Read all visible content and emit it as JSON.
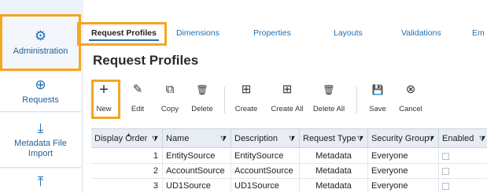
{
  "sidebar": {
    "items": [
      {
        "label": "Administration",
        "icon": "gear-plus-icon",
        "glyph": "⚙",
        "active": true
      },
      {
        "label": "Requests",
        "icon": "add-request-icon",
        "glyph": "⊕",
        "active": false
      },
      {
        "label": "Metadata File Import",
        "icon": "download-icon",
        "glyph": "⤓",
        "active": false
      },
      {
        "label": "",
        "icon": "upload-icon",
        "glyph": "⤒",
        "active": false
      }
    ]
  },
  "tabs": [
    {
      "label": "Request Profiles",
      "active": true
    },
    {
      "label": "Dimensions",
      "active": false
    },
    {
      "label": "Properties",
      "active": false
    },
    {
      "label": "Layouts",
      "active": false
    },
    {
      "label": "Validations",
      "active": false
    },
    {
      "label": "Em",
      "active": false
    }
  ],
  "page_title": "Request Profiles",
  "toolbar": {
    "new": {
      "label": "New",
      "glyph": "+"
    },
    "edit": {
      "label": "Edit",
      "glyph": "✎"
    },
    "copy": {
      "label": "Copy",
      "glyph": "⧉"
    },
    "delete": {
      "label": "Delete",
      "glyph": "🗑"
    },
    "create": {
      "label": "Create",
      "glyph": "⊞"
    },
    "create_all": {
      "label": "Create All",
      "glyph": "⊞"
    },
    "delete_all": {
      "label": "Delete All",
      "glyph": "🗑"
    },
    "save": {
      "label": "Save",
      "glyph": "💾"
    },
    "cancel": {
      "label": "Cancel",
      "glyph": "⊗"
    }
  },
  "grid": {
    "columns": [
      "Display Order",
      "Name",
      "Description",
      "Request Type",
      "Security Group",
      "Enabled"
    ],
    "rows": [
      {
        "order": "1",
        "name": "EntitySource",
        "description": "EntitySource",
        "type": "Metadata",
        "group": "Everyone",
        "enabled": false
      },
      {
        "order": "2",
        "name": "AccountSource",
        "description": "AccountSource",
        "type": "Metadata",
        "group": "Everyone",
        "enabled": false
      },
      {
        "order": "3",
        "name": "UD1Source",
        "description": "UD1Source",
        "type": "Metadata",
        "group": "Everyone",
        "enabled": false
      }
    ],
    "filter_glyph": "⧩"
  },
  "colors": {
    "accent": "#1f6fb2",
    "highlight": "#f5a623",
    "rail_bg": "#eef3f9",
    "header_bg": "#e8edf3"
  }
}
